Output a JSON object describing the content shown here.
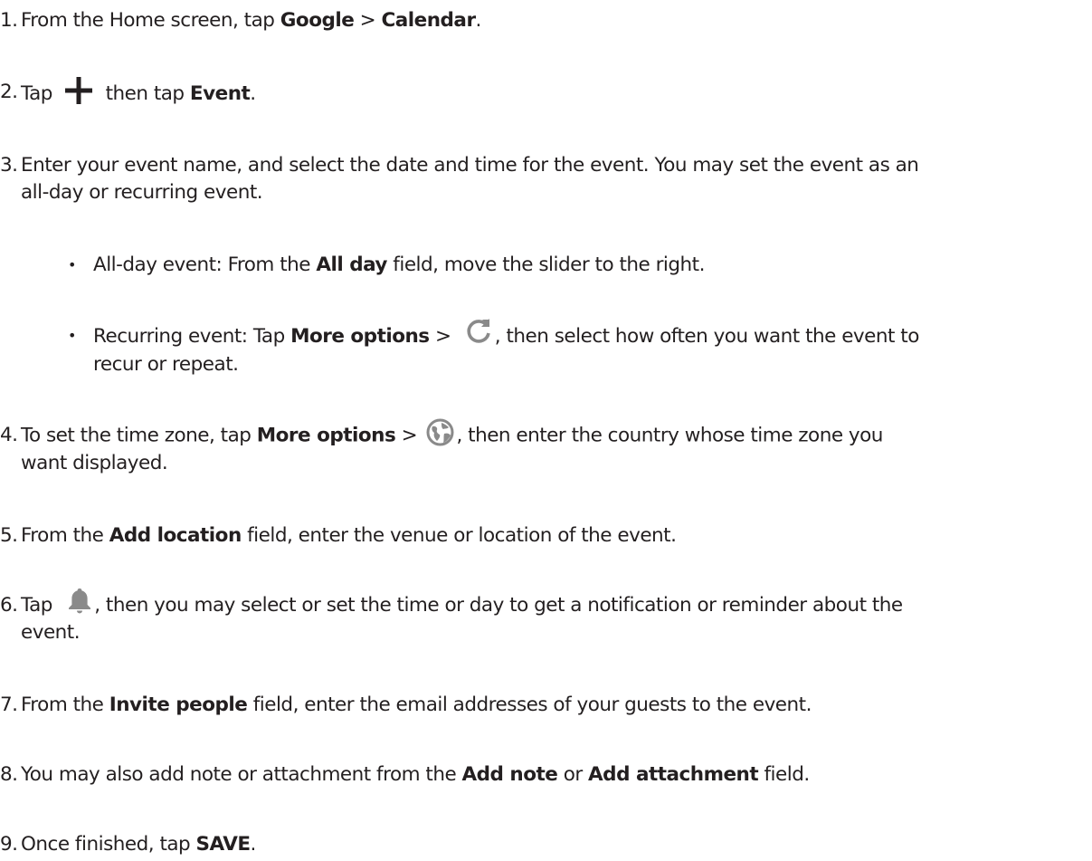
{
  "steps": [
    {
      "num": "1.",
      "a": "From the Home screen, tap ",
      "b1": "Google",
      "c": " > ",
      "b2": "Calendar",
      "d": "."
    },
    {
      "num": "2.",
      "a": "Tap",
      "c": " then tap ",
      "b1": "Event",
      "d": "."
    },
    {
      "num": "3.",
      "a": "Enter your event name, and select the date and time for the event.  You may set the event as an",
      "e": "all-day or recurring event."
    },
    {
      "num": "4.",
      "a": "To set the time zone, tap ",
      "b1": "More options",
      "c": " > ",
      "d": ", then enter the country whose time zone you",
      "e": "want displayed."
    },
    {
      "num": "5.",
      "a": "From the ",
      "b1": "Add location",
      "d": " field, enter the venue or location of the event."
    },
    {
      "num": "6.",
      "a": "Tap",
      "d": ", then you may select or set the time or day to get a notification or reminder about the",
      "e": "event."
    },
    {
      "num": "7.",
      "a": "From the ",
      "b1": "Invite people",
      "d": " field, enter the email addresses of your guests to the event."
    },
    {
      "num": "8.",
      "a": "You may also add note or attachment from the ",
      "b1": "Add note",
      "c": " or ",
      "b2": "Add attachment",
      "d": " field."
    },
    {
      "num": "9.",
      "a": "Once finished, tap ",
      "b1": "SAVE",
      "d": "."
    }
  ],
  "bullets": [
    {
      "mark": "•",
      "a": "All-day event: From the ",
      "b1": "All day",
      "d": " field, move the slider to the right."
    },
    {
      "mark": "•",
      "a": "Recurring event: Tap ",
      "b1": "More options",
      "c": "  > ",
      "d": ", then select how often you want the event to",
      "e": "recur or repeat."
    }
  ],
  "icons": {
    "step2": "plus-icon",
    "bullet2": "refresh-icon",
    "step4": "globe-icon",
    "step6": "bell-icon"
  },
  "colors": {
    "text": "#231f20",
    "icon": "#231f20",
    "icon_gray": "#8a8a8a"
  }
}
